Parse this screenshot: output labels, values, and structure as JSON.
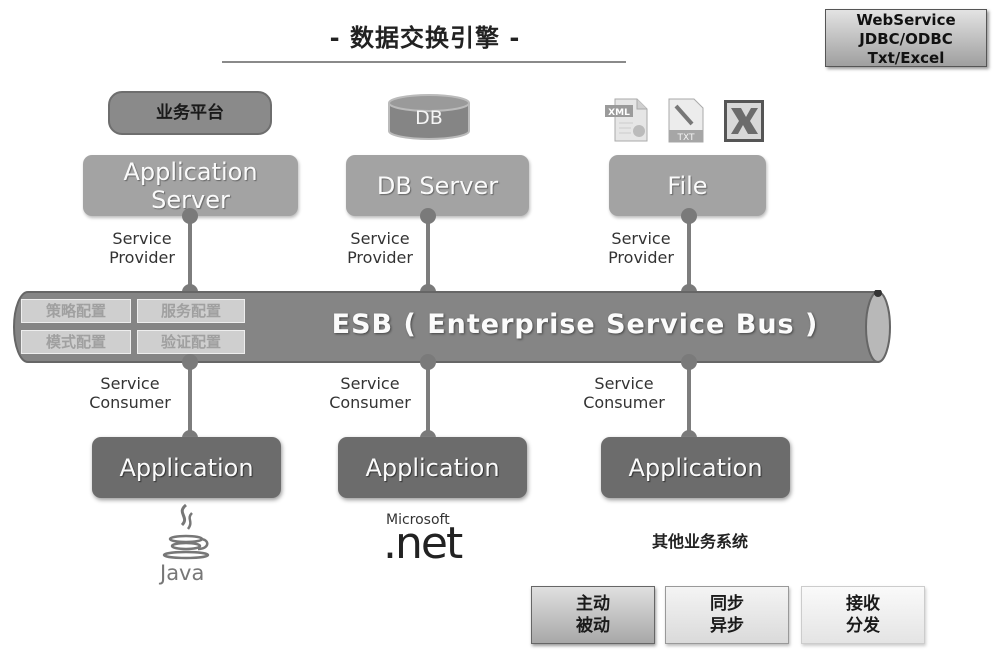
{
  "title": "- 数据交换引擎 -",
  "protocols": {
    "icon": "protocol-list-box",
    "lines": [
      "WebService",
      "JDBC/ODBC",
      "Txt/Excel"
    ]
  },
  "top_sources": {
    "platform_label": "业务平台",
    "db_label": "DB",
    "file_icons": [
      "xml-file-icon",
      "txt-file-icon",
      "excel-file-icon"
    ],
    "file_icon_labels": {
      "xml": "XML",
      "txt": "TXT"
    }
  },
  "servers": [
    {
      "label_line1": "Application",
      "label_line2": "Server",
      "role_line1": "Service",
      "role_line2": "Provider"
    },
    {
      "label_line1": "DB Server",
      "label_line2": "",
      "role_line1": "Service",
      "role_line2": "Provider"
    },
    {
      "label_line1": "File",
      "label_line2": "",
      "role_line1": "Service",
      "role_line2": "Provider"
    }
  ],
  "esb": {
    "label": "ESB ( Enterprise Service Bus )",
    "config_items": [
      "策略配置",
      "服务配置",
      "模式配置",
      "验证配置"
    ]
  },
  "consumers": [
    {
      "role_line1": "Service",
      "role_line2": "Consumer",
      "label": "Application",
      "platform": "Java"
    },
    {
      "role_line1": "Service",
      "role_line2": "Consumer",
      "label": "Application",
      "platform_top": "Microsoft",
      "platform": ".net"
    },
    {
      "role_line1": "Service",
      "role_line2": "Consumer",
      "label": "Application",
      "platform": "其他业务系统"
    }
  ],
  "modes": [
    {
      "line1": "主动",
      "line2": "被动"
    },
    {
      "line1": "同步",
      "line2": "异步"
    },
    {
      "line1": "接收",
      "line2": "分发"
    }
  ],
  "colors": {
    "server_fill": "#a3a3a3",
    "app_fill": "#6c6c6c",
    "bus_fill": "#858585",
    "connector": "#7d7d7d"
  }
}
